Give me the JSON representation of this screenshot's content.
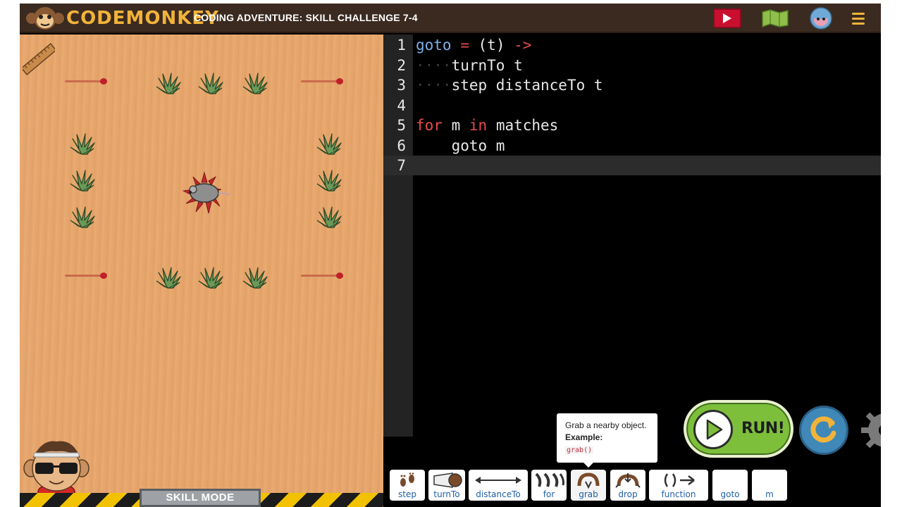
{
  "header": {
    "logo_text": "CODEMONKEY",
    "level_title": "CODING ADVENTURE: SKILL CHALLENGE 7-4"
  },
  "game": {
    "mode_label": "SKILL MODE"
  },
  "editor": {
    "lines": [
      {
        "num": "1",
        "tokens": [
          [
            "fn",
            "goto"
          ],
          [
            "txt",
            " "
          ],
          [
            "op",
            "="
          ],
          [
            "txt",
            " (t) "
          ],
          [
            "op",
            "->"
          ]
        ]
      },
      {
        "num": "2",
        "tokens": [
          [
            "dim",
            "····"
          ],
          [
            "txt",
            "turnTo t"
          ]
        ]
      },
      {
        "num": "3",
        "tokens": [
          [
            "dim",
            "····"
          ],
          [
            "txt",
            "step distanceTo t"
          ]
        ]
      },
      {
        "num": "4",
        "tokens": []
      },
      {
        "num": "5",
        "tokens": [
          [
            "kw",
            "for"
          ],
          [
            "txt",
            " m "
          ],
          [
            "kw",
            "in"
          ],
          [
            "txt",
            " matches"
          ]
        ]
      },
      {
        "num": "6",
        "tokens": [
          [
            "txt",
            "    goto m"
          ]
        ]
      },
      {
        "num": "7",
        "tokens": []
      }
    ]
  },
  "tooltip": {
    "description": "Grab a nearby object.",
    "example_label": "Example:",
    "example_code": "grab()"
  },
  "commands": {
    "step": "step",
    "turnTo": "turnTo",
    "distanceTo": "distanceTo",
    "for": "for",
    "grab": "grab",
    "drop": "drop",
    "function": "function",
    "goto": "goto",
    "m": "m"
  },
  "controls": {
    "run_label": "RUN!"
  },
  "colors": {
    "accent": "#f2b33a",
    "run_green": "#7dbf3b",
    "reset_blue": "#3f88b8",
    "video_red": "#c8102e"
  }
}
